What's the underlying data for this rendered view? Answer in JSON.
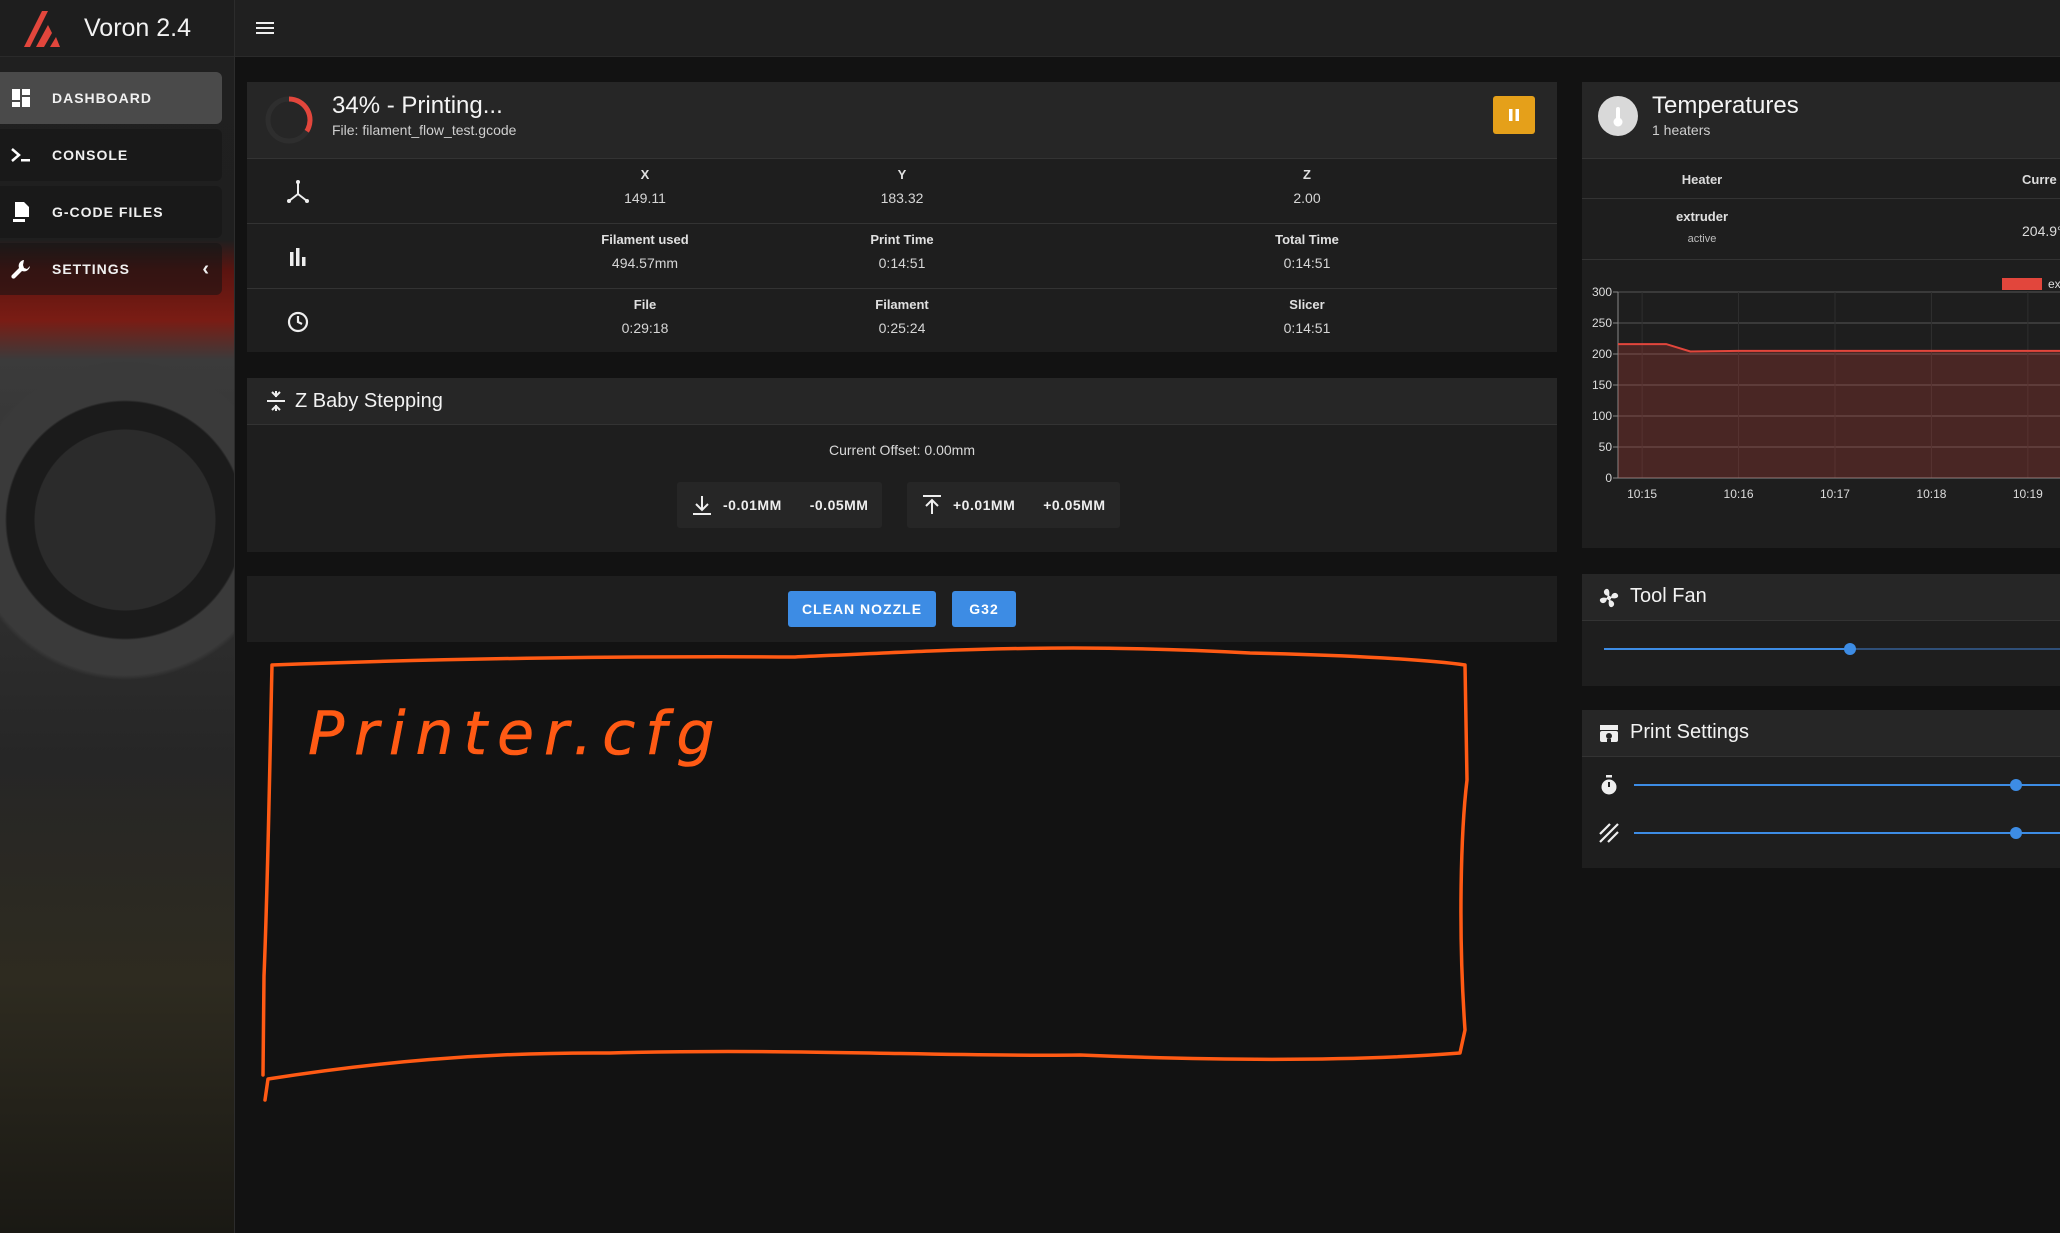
{
  "app": {
    "title": "Voron 2.4"
  },
  "nav": [
    {
      "label": "DASHBOARD",
      "icon": "dashboard-icon",
      "active": true
    },
    {
      "label": "CONSOLE",
      "icon": "console-icon"
    },
    {
      "label": "G-CODE FILES",
      "icon": "file-upload-icon"
    },
    {
      "label": "SETTINGS",
      "icon": "wrench-icon",
      "chevron": "‹"
    }
  ],
  "status": {
    "title": "34% - Printing...",
    "file": "File: filament_flow_test.gcode",
    "progress": 0.34,
    "position": [
      {
        "label": "X",
        "value": "149.11"
      },
      {
        "label": "Y",
        "value": "183.32"
      },
      {
        "label": "Z",
        "value": "2.00"
      }
    ],
    "stats": [
      {
        "label": "Filament used",
        "value": "494.57mm"
      },
      {
        "label": "Print Time",
        "value": "0:14:51"
      },
      {
        "label": "Total Time",
        "value": "0:14:51"
      }
    ],
    "estimates": [
      {
        "label": "File",
        "value": "0:29:18"
      },
      {
        "label": "Filament",
        "value": "0:25:24"
      },
      {
        "label": "Slicer",
        "value": "0:14:51"
      }
    ],
    "pause_color": "#e5a01a"
  },
  "baby": {
    "title": "Z Baby Stepping",
    "offset": "Current Offset: 0.00mm",
    "down": [
      "-0.01MM",
      "-0.05MM"
    ],
    "up": [
      "+0.01MM",
      "+0.05MM"
    ]
  },
  "macros": {
    "clean": "CLEAN NOZZLE",
    "g32": "G32",
    "color": "#3d8ce4"
  },
  "annotation": {
    "text": "Printer.cfg",
    "color": "#ff5a14"
  },
  "temps": {
    "title": "Temperatures",
    "subtitle": "1 heaters",
    "col_heater": "Heater",
    "col_current": "Curre",
    "heater": {
      "name": "extruder",
      "state": "active",
      "current": "204.9°"
    },
    "legend": "ext"
  },
  "chart_data": {
    "type": "line",
    "series": [
      {
        "name": "extruder",
        "x": [
          "10:14:45",
          "10:15:00",
          "10:15:15",
          "10:15:30",
          "10:16:00",
          "10:17:00",
          "10:18:00",
          "10:19:00",
          "10:19:20"
        ],
        "values": [
          216,
          216,
          216,
          204,
          205,
          205,
          205,
          205,
          205
        ]
      }
    ],
    "yticks": [
      "0",
      "50",
      "100",
      "150",
      "200",
      "250",
      "300"
    ],
    "xticks": [
      "10:15",
      "10:16",
      "10:17",
      "10:18",
      "10:19"
    ],
    "ylim": [
      0,
      300
    ],
    "grid": true,
    "color": "#e2463c"
  },
  "toolfan": {
    "title": "Tool Fan",
    "level": 0.54
  },
  "printsettings": {
    "title": "Print Settings",
    "speed_level": 1.0,
    "flow_level": 1.0
  }
}
